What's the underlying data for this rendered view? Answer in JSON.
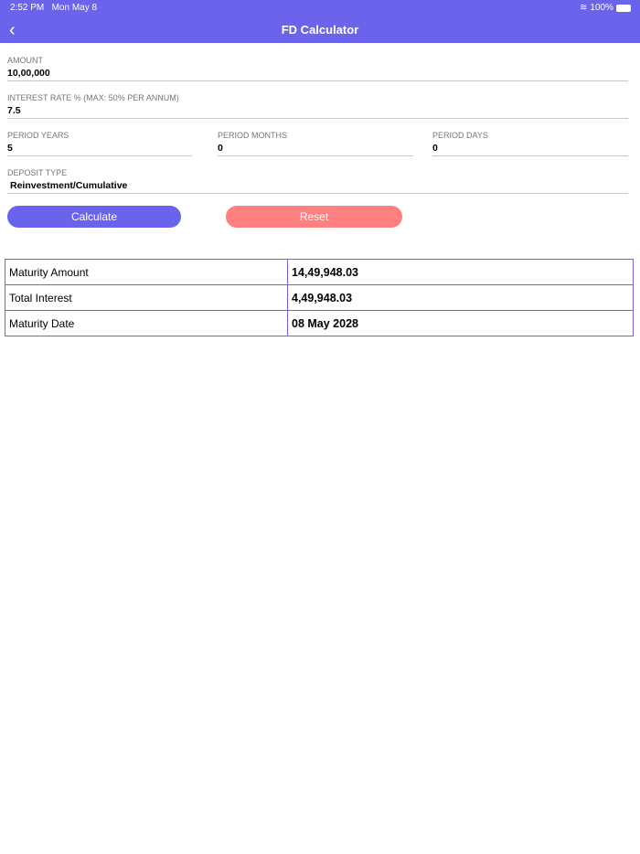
{
  "status": {
    "time": "2:52 PM",
    "date": "Mon May 8",
    "battery": "100%"
  },
  "header": {
    "back": "‹",
    "title": "FD Calculator"
  },
  "form": {
    "amount": {
      "label": "AMOUNT",
      "value": "10,00,000"
    },
    "rate": {
      "label": "INTEREST RATE % (MAX: 50% PER ANNUM)",
      "value": "7.5"
    },
    "years": {
      "label": "PERIOD YEARS",
      "value": "5"
    },
    "months": {
      "label": "PERIOD MONTHS",
      "value": "0"
    },
    "days": {
      "label": "PERIOD DAYS",
      "value": "0"
    },
    "deposit": {
      "label": "DEPOSIT TYPE",
      "value": "Reinvestment/Cumulative"
    }
  },
  "buttons": {
    "calculate": "Calculate",
    "reset": "Reset"
  },
  "results": [
    {
      "label": "Maturity Amount",
      "value": "14,49,948.03"
    },
    {
      "label": "Total Interest",
      "value": "4,49,948.03"
    },
    {
      "label": "Maturity Date",
      "value": "08 May 2028"
    }
  ]
}
